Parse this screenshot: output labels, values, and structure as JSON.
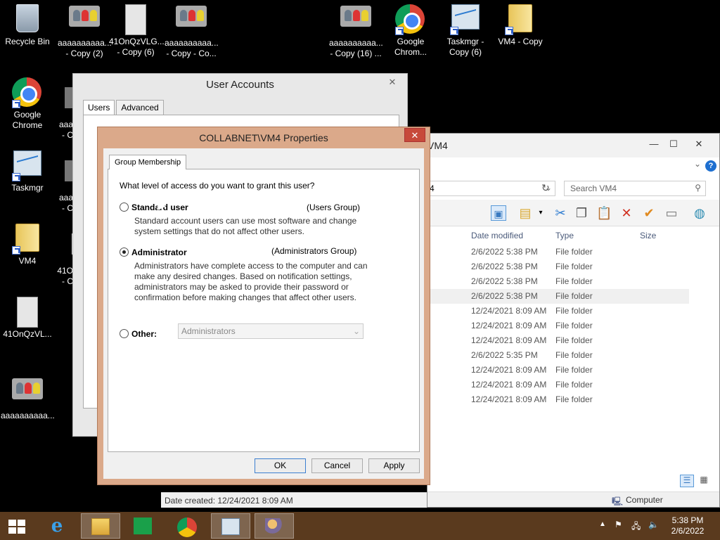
{
  "desktop": {
    "icons": [
      {
        "label": "Recycle Bin"
      },
      {
        "label": "aaaaaaaaaa...\n- Copy (2)"
      },
      {
        "label": "41OnQzVLG...\n- Copy (6)"
      },
      {
        "label": "aaaaaaaaaa...\n- Copy - Co..."
      },
      {
        "label": "aaaaaaaaaa...\n- Copy (16) ..."
      },
      {
        "label": "Google\nChrom..."
      },
      {
        "label": "Taskmgr -\nCopy (6)"
      },
      {
        "label": "VM4 - Copy"
      },
      {
        "label": "Google\nChrome"
      },
      {
        "label": "Taskmgr"
      },
      {
        "label": "VM4"
      },
      {
        "label": "41OnQzVL..."
      },
      {
        "label": "aaaaaaaaaa..."
      },
      {
        "label": "aaa\n- C"
      },
      {
        "label": "aaa\n- C"
      },
      {
        "label": "41O\n- C"
      }
    ]
  },
  "user_accounts": {
    "title": "User Accounts",
    "close": "✕",
    "tabs": [
      "Users",
      "Advanced"
    ]
  },
  "explorer": {
    "title": "VM4",
    "address": "4",
    "search_placeholder": "Search VM4",
    "columns": {
      "date": "Date modified",
      "type": "Type",
      "size": "Size"
    },
    "rows": [
      {
        "date": "2/6/2022 5:38 PM",
        "type": "File folder"
      },
      {
        "date": "2/6/2022 5:38 PM",
        "type": "File folder"
      },
      {
        "date": "2/6/2022 5:38 PM",
        "type": "File folder"
      },
      {
        "date": "2/6/2022 5:38 PM",
        "type": "File folder"
      },
      {
        "date": "12/24/2021 8:09 AM",
        "type": "File folder"
      },
      {
        "date": "12/24/2021 8:09 AM",
        "type": "File folder"
      },
      {
        "date": "12/24/2021 8:09 AM",
        "type": "File folder"
      },
      {
        "date": "2/6/2022 5:35 PM",
        "type": "File folder"
      },
      {
        "date": "12/24/2021 8:09 AM",
        "type": "File folder"
      },
      {
        "date": "12/24/2021 8:09 AM",
        "type": "File folder"
      },
      {
        "date": "12/24/2021 8:09 AM",
        "type": "File folder"
      }
    ],
    "status_left": "Date created: 12/24/2021 8:09 AM",
    "status_right": "Computer"
  },
  "properties": {
    "title": "COLLABNET\\VM4 Properties",
    "close": "✕",
    "tab": "Group Membership",
    "question": "What level of access do you want to grant this user?",
    "standard": {
      "label": "Standard user",
      "group": "(Users Group)",
      "desc": "Standard account users can use most software and change system settings that do not affect other users."
    },
    "admin": {
      "label": "Administrator",
      "group": "(Administrators Group)",
      "desc": "Administrators have complete access to the computer and can make any desired changes. Based on notification settings, administrators may be asked to provide their password or confirmation before making changes that affect other users."
    },
    "other": {
      "label": "Other:",
      "value": "Administrators"
    },
    "buttons": {
      "ok": "OK",
      "cancel": "Cancel",
      "apply": "Apply"
    }
  },
  "taskbar": {
    "time": "5:38 PM",
    "date": "2/6/2022"
  }
}
